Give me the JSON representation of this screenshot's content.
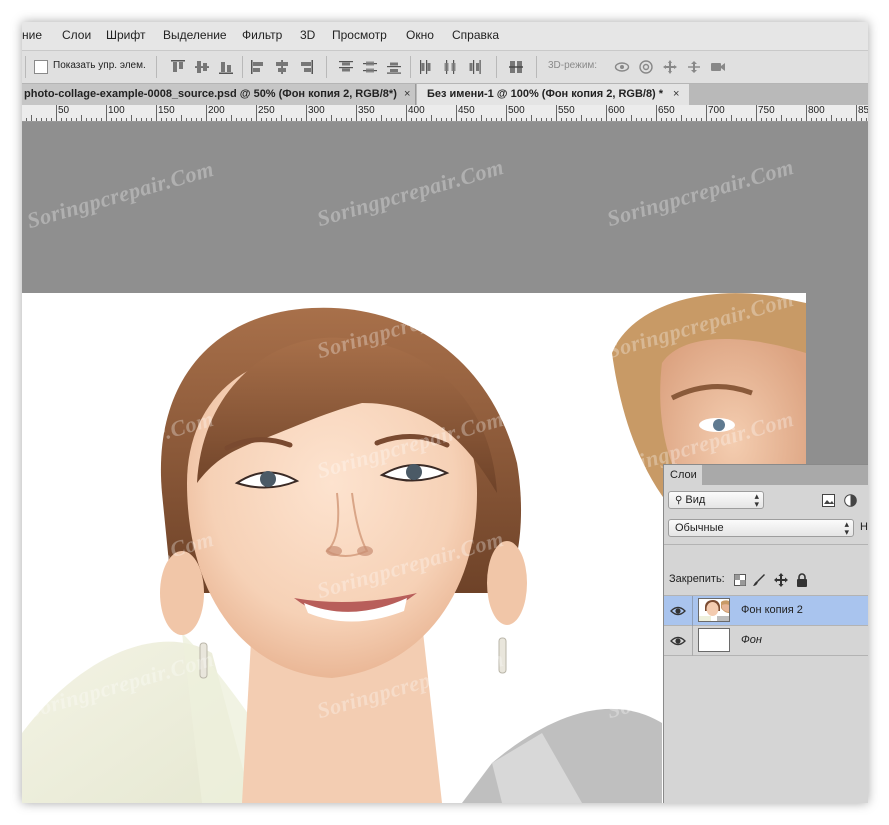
{
  "menubar": {
    "items": [
      "ние",
      "Слои",
      "Шрифт",
      "Выделение",
      "Фильтр",
      "3D",
      "Просмотр",
      "Окно",
      "Справка"
    ]
  },
  "options_bar": {
    "show_transform_label": "Показать упр. элем.",
    "mode_label": "3D-режим:",
    "align_icons": [
      "align-top-icon",
      "align-vcenter-icon",
      "align-bottom-icon",
      "align-left-icon",
      "align-hcenter-icon",
      "align-right-icon"
    ],
    "distribute_icons": [
      "dist-top-icon",
      "dist-vcenter-icon",
      "dist-bottom-icon",
      "dist-left-icon",
      "dist-hcenter-icon",
      "dist-right-icon"
    ],
    "mode_icons": [
      "orbit-icon",
      "roll-icon",
      "pan-icon",
      "slide-icon",
      "scale-camera-icon"
    ]
  },
  "tabs": [
    {
      "label": "photo-collage-example-0008_source.psd @ 50% (Фон копия 2, RGB/8*)",
      "close": "×"
    },
    {
      "label": "Без имени-1 @ 100% (Фон копия 2, RGB/8) *",
      "close": "×"
    }
  ],
  "ruler": {
    "labels": [
      "50",
      "100",
      "150",
      "200",
      "250",
      "300",
      "350",
      "400",
      "450",
      "500",
      "550",
      "600",
      "650",
      "700",
      "750",
      "800",
      "85"
    ]
  },
  "layers_panel": {
    "tab_label": "Слои",
    "filter_select": "Вид",
    "blend_mode": "Обычные",
    "blend_cut_text": "Н",
    "lock_label": "Закрепить:",
    "layers": [
      {
        "name": "Фон копия 2",
        "selected": true,
        "visible": true
      },
      {
        "name": "Фон",
        "selected": false,
        "visible": true
      }
    ]
  },
  "watermark": "Soringpcrepair.Com",
  "colors": {
    "workspace": "#8f8f8f",
    "selected_layer": "#a9c4ee",
    "menubar": "#e6e6e6"
  }
}
